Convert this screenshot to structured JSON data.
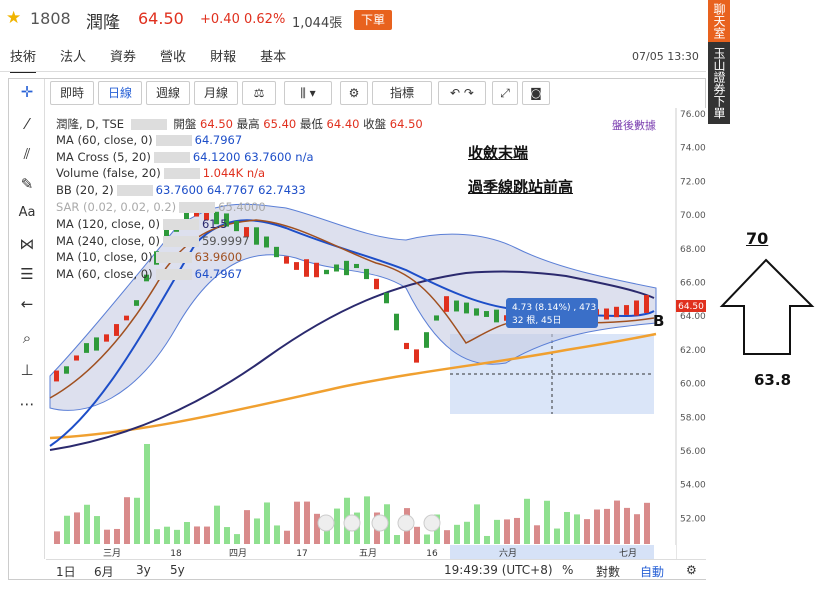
{
  "header": {
    "code": "1808",
    "name": "潤隆",
    "price": "64.50",
    "change": "+0.40",
    "change_pct": "0.62%",
    "volume": "1,044張",
    "order_button": "下單",
    "side_top": "聊天室",
    "side_bottom": "玉山證券下單",
    "datetime": "07/05 13:30"
  },
  "tabs": [
    "技術",
    "法人",
    "資券",
    "營收",
    "財報",
    "基本"
  ],
  "toolbar": {
    "realtime": "即時",
    "daily": "日線",
    "weekly": "週線",
    "monthly": "月線",
    "indicators": "指標"
  },
  "legend": {
    "title_line": "潤隆, D, TSE",
    "open_label": "開盤",
    "open": "64.50",
    "high_label": "最高",
    "high": "65.40",
    "low_label": "最低",
    "low": "64.40",
    "close_label": "收盤",
    "close": "64.50",
    "after_hours": "盤後數據",
    "ma60": "MA (60, close, 0)",
    "ma60_val": "64.7967",
    "macross": "MA Cross (5, 20)",
    "macross_val": "64.1200 63.7600 n/a",
    "volume": "Volume (false, 20)",
    "volume_val": "1.044K n/a",
    "bb": "BB (20, 2)",
    "bb_val": "63.7600 64.7767 62.7433",
    "sar": "SAR (0.02, 0.02, 0.2)",
    "sar_val": "65.4000",
    "ma120": "MA (120, close, 0)",
    "ma120_val": "61.5",
    "ma240": "MA (240, close, 0)",
    "ma240_val": "59.9997",
    "ma10": "MA (10, close, 0)",
    "ma10_val": "63.9600",
    "ma60b": "MA (60, close, 0)",
    "ma60b_val": "64.7967"
  },
  "price_axis": [
    "76.00",
    "74.00",
    "72.00",
    "70.00",
    "68.00",
    "66.00",
    "64.00",
    "62.00",
    "60.00",
    "58.00",
    "56.00",
    "54.00",
    "52.00"
  ],
  "price_tag": "64.50",
  "time_axis": [
    "三月",
    "18",
    "四月",
    "17",
    "五月",
    "16",
    "六月",
    "七月"
  ],
  "measure_box": {
    "line1": "4.73 (8.14%) , 473",
    "line2": "32 根, 45日"
  },
  "bottom": {
    "ranges": [
      "1日",
      "6月",
      "3y",
      "5y"
    ],
    "clock": "19:49:39 (UTC+8)",
    "percent": "%",
    "log": "對數",
    "auto": "自動"
  },
  "annotations": {
    "line1": "收斂末端",
    "line2": "過季線跳站前高",
    "arrow_target": "70",
    "arrow_base": "63.8",
    "mark": "B"
  },
  "colors": {
    "up": "#e0301e",
    "accent": "#e8621e",
    "link": "#2962d6"
  }
}
